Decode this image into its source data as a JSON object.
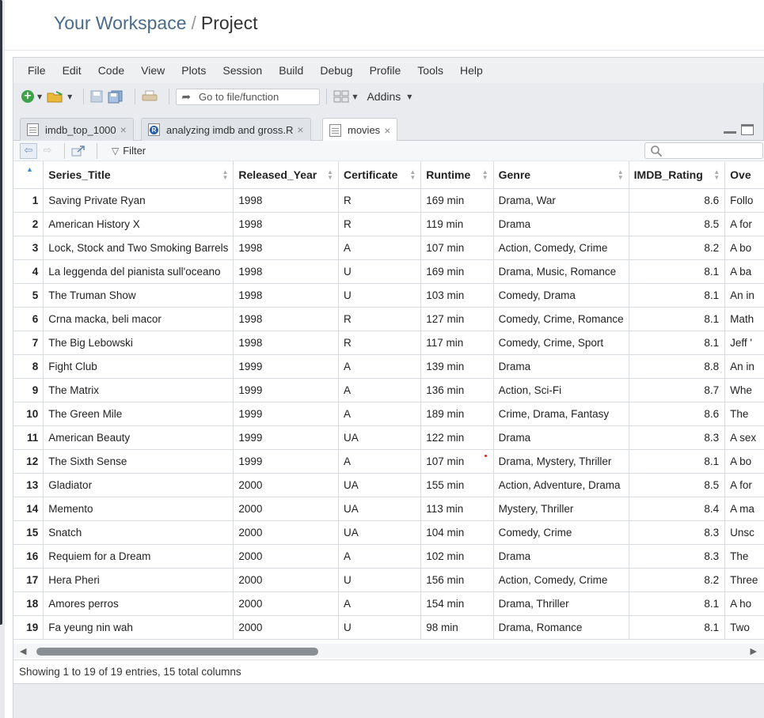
{
  "breadcrumb": {
    "workspace": "Your Workspace",
    "separator": "/",
    "project": "Project"
  },
  "menu": [
    "File",
    "Edit",
    "Code",
    "View",
    "Plots",
    "Session",
    "Build",
    "Debug",
    "Profile",
    "Tools",
    "Help"
  ],
  "toolbar": {
    "goto_placeholder": "Go to file/function",
    "addins_label": "Addins"
  },
  "tabs": [
    {
      "label": "imdb_top_1000",
      "type": "data"
    },
    {
      "label": "analyzing imdb and gross.R",
      "type": "r-script"
    },
    {
      "label": "movies",
      "type": "data",
      "active": true
    }
  ],
  "viewer": {
    "filter_label": "Filter",
    "search_placeholder": ""
  },
  "table": {
    "columns": [
      "Series_Title",
      "Released_Year",
      "Certificate",
      "Runtime",
      "Genre",
      "IMDB_Rating",
      "Ove"
    ],
    "rows": [
      {
        "n": "1",
        "title": "Saving Private Ryan",
        "year": "1998",
        "cert": "R",
        "runtime": "169 min",
        "genre": "Drama, War",
        "rating": "8.6",
        "overview": "Follo"
      },
      {
        "n": "2",
        "title": "American History X",
        "year": "1998",
        "cert": "R",
        "runtime": "119 min",
        "genre": "Drama",
        "rating": "8.5",
        "overview": "A for"
      },
      {
        "n": "3",
        "title": "Lock, Stock and Two Smoking Barrels",
        "year": "1998",
        "cert": "A",
        "runtime": "107 min",
        "genre": "Action, Comedy, Crime",
        "rating": "8.2",
        "overview": "A bo"
      },
      {
        "n": "4",
        "title": "La leggenda del pianista sull'oceano",
        "year": "1998",
        "cert": "U",
        "runtime": "169 min",
        "genre": "Drama, Music, Romance",
        "rating": "8.1",
        "overview": "A ba"
      },
      {
        "n": "5",
        "title": "The Truman Show",
        "year": "1998",
        "cert": "U",
        "runtime": "103 min",
        "genre": "Comedy, Drama",
        "rating": "8.1",
        "overview": "An in"
      },
      {
        "n": "6",
        "title": "Crna macka, beli macor",
        "year": "1998",
        "cert": "R",
        "runtime": "127 min",
        "genre": "Comedy, Crime, Romance",
        "rating": "8.1",
        "overview": "Math"
      },
      {
        "n": "7",
        "title": "The Big Lebowski",
        "year": "1998",
        "cert": "R",
        "runtime": "117 min",
        "genre": "Comedy, Crime, Sport",
        "rating": "8.1",
        "overview": "Jeff '"
      },
      {
        "n": "8",
        "title": "Fight Club",
        "year": "1999",
        "cert": "A",
        "runtime": "139 min",
        "genre": "Drama",
        "rating": "8.8",
        "overview": "An in"
      },
      {
        "n": "9",
        "title": "The Matrix",
        "year": "1999",
        "cert": "A",
        "runtime": "136 min",
        "genre": "Action, Sci-Fi",
        "rating": "8.7",
        "overview": "Whe"
      },
      {
        "n": "10",
        "title": "The Green Mile",
        "year": "1999",
        "cert": "A",
        "runtime": "189 min",
        "genre": "Crime, Drama, Fantasy",
        "rating": "8.6",
        "overview": "The"
      },
      {
        "n": "11",
        "title": "American Beauty",
        "year": "1999",
        "cert": "UA",
        "runtime": "122 min",
        "genre": "Drama",
        "rating": "8.3",
        "overview": "A sex"
      },
      {
        "n": "12",
        "title": "The Sixth Sense",
        "year": "1999",
        "cert": "A",
        "runtime": "107 min",
        "genre": "Drama, Mystery, Thriller",
        "rating": "8.1",
        "overview": "A bo"
      },
      {
        "n": "13",
        "title": "Gladiator",
        "year": "2000",
        "cert": "UA",
        "runtime": "155 min",
        "genre": "Action, Adventure, Drama",
        "rating": "8.5",
        "overview": "A for"
      },
      {
        "n": "14",
        "title": "Memento",
        "year": "2000",
        "cert": "UA",
        "runtime": "113 min",
        "genre": "Mystery, Thriller",
        "rating": "8.4",
        "overview": "A ma"
      },
      {
        "n": "15",
        "title": "Snatch",
        "year": "2000",
        "cert": "UA",
        "runtime": "104 min",
        "genre": "Comedy, Crime",
        "rating": "8.3",
        "overview": "Unsc"
      },
      {
        "n": "16",
        "title": "Requiem for a Dream",
        "year": "2000",
        "cert": "A",
        "runtime": "102 min",
        "genre": "Drama",
        "rating": "8.3",
        "overview": "The"
      },
      {
        "n": "17",
        "title": "Hera Pheri",
        "year": "2000",
        "cert": "U",
        "runtime": "156 min",
        "genre": "Action, Comedy, Crime",
        "rating": "8.2",
        "overview": "Three"
      },
      {
        "n": "18",
        "title": "Amores perros",
        "year": "2000",
        "cert": "A",
        "runtime": "154 min",
        "genre": "Drama, Thriller",
        "rating": "8.1",
        "overview": "A ho"
      },
      {
        "n": "19",
        "title": "Fa yeung nin wah",
        "year": "2000",
        "cert": "U",
        "runtime": "98 min",
        "genre": "Drama, Romance",
        "rating": "8.1",
        "overview": "Two"
      }
    ]
  },
  "status": {
    "text": "Showing 1 to 19 of 19 entries, 15 total columns"
  },
  "colors": {
    "breadcrumb_workspace": "#4a6b8a",
    "new_file_green": "#3fa24a",
    "sort_active": "#3b8fd9",
    "scroll_thumb": "#8a8f96"
  },
  "icons": [
    "new-file-icon",
    "open-folder-icon",
    "save-icon",
    "save-all-icon",
    "print-icon",
    "goto-arrow-icon",
    "grid-layout-icon",
    "back-arrow-icon",
    "forward-arrow-icon",
    "popout-icon",
    "funnel-icon",
    "search-icon",
    "minimize-icon",
    "maximize-icon",
    "close-icon"
  ]
}
